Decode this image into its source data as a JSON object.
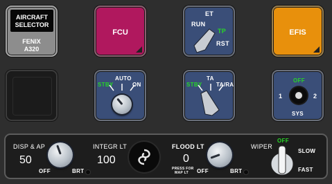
{
  "aircraft": {
    "header": [
      "AIRCRAFT",
      "SELECTOR"
    ],
    "name": "FENIX",
    "model": "A320"
  },
  "fcu": {
    "label": "FCU",
    "color": "#b0185e"
  },
  "efis": {
    "label": "EFIS",
    "color": "#e8900c"
  },
  "et": {
    "title": "ET",
    "run": "RUN",
    "tp": "TP",
    "rst": "RST"
  },
  "stby_switch": {
    "auto": "AUTO",
    "stby": "STBY",
    "on": "ON"
  },
  "xpdr": {
    "ta": "TA",
    "stby": "STBY",
    "tara": "TA/RA"
  },
  "sys": {
    "off": "OFF",
    "one": "1",
    "two": "2",
    "label": "SYS"
  },
  "bottom": {
    "disp_ap": {
      "label": "DISP & AP",
      "value": "50",
      "off": "OFF",
      "brt": "BRT"
    },
    "integ_lt": {
      "label": "INTEGR LT",
      "value": "100"
    },
    "flood_lt": {
      "label": "FLOOD LT",
      "value": "0",
      "press": "PRESS FOR",
      "map": "MAP LT",
      "off": "OFF",
      "brt": "BRT"
    },
    "wiper": {
      "label": "WIPER",
      "off": "OFF",
      "slow": "SLOW",
      "fast": "FAST"
    }
  },
  "colors": {
    "green": "#27d627",
    "panel_blue": "#3a4e78",
    "background": "#2e2e2e"
  },
  "icons": [
    "pointer-knob-icon",
    "swirl-logo-icon",
    "wiper-knob-icon"
  ]
}
